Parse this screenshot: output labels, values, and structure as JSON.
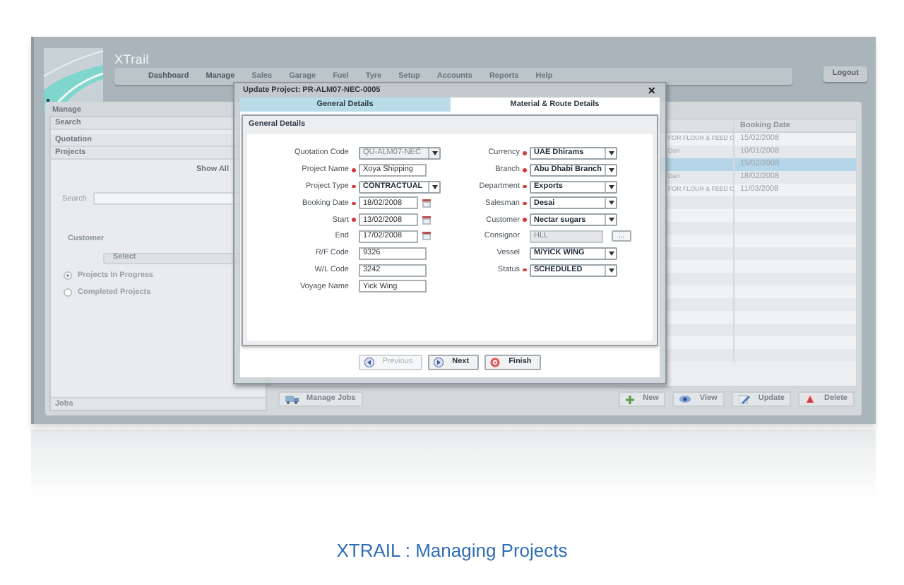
{
  "app": {
    "brand": "XTrail",
    "nav": [
      "Dashboard",
      "Manage",
      "Sales",
      "Garage",
      "Fuel",
      "Tyre",
      "Setup",
      "Accounts",
      "Reports",
      "Help"
    ],
    "logout": "Logout"
  },
  "manage_panel": {
    "title": "Manage",
    "sections": [
      "Search",
      "Quotation",
      "Projects"
    ],
    "show_all": "Show All",
    "search_label": "Search",
    "customer_label": "Customer",
    "customer_select": "Select",
    "radios": [
      {
        "label": "Projects In Progress",
        "selected": true
      },
      {
        "label": "Completed Projects",
        "selected": false
      }
    ],
    "footer": "Jobs"
  },
  "table": {
    "booking_date_header": "Booking Date",
    "rows": [
      {
        "column_1": "FOR FLOUR & FEED C",
        "booking_date": "15/02/2008",
        "selected": false
      },
      {
        "column_1": "Dan",
        "booking_date": "10/01/2008",
        "selected": false
      },
      {
        "booking_date": "15/02/2008",
        "selected": true
      },
      {
        "column_1": "Dan",
        "booking_date": "18/02/2008",
        "selected": false
      },
      {
        "column_1": "FOR FLOUR & FEED C",
        "booking_date": "11/03/2008",
        "selected": false
      }
    ]
  },
  "bottom_bar": {
    "manage_jobs": "Manage Jobs",
    "actions": [
      {
        "label": "New",
        "kind": "new"
      },
      {
        "label": "View",
        "kind": "view"
      },
      {
        "label": "Update",
        "kind": "update"
      },
      {
        "label": "Delete",
        "kind": "delete"
      }
    ]
  },
  "dialog": {
    "title": "Update Project: PR-ALM07-NEC-0005",
    "close": "×",
    "tabs": [
      {
        "label": "General Details",
        "selected": true
      },
      {
        "label": "Material & Route Details",
        "selected": false
      }
    ],
    "section_title": "General Details",
    "left_fields": [
      {
        "label": "Quotation Code",
        "required": false,
        "kind": "select",
        "value": "QU-ALM07-NEC",
        "disabled": true
      },
      {
        "label": "Project Name",
        "required": true,
        "kind": "text",
        "value": "Xoya Shipping",
        "disabled": false
      },
      {
        "label": "Project Type",
        "required": true,
        "kind": "select",
        "value": "CONTRACTUAL",
        "disabled": false
      },
      {
        "label": "Booking Date",
        "required": true,
        "kind": "date",
        "value": "18/02/2008",
        "disabled": false
      },
      {
        "label": "Start",
        "required": true,
        "kind": "date",
        "value": "13/02/2008",
        "disabled": false
      },
      {
        "label": "End",
        "required": false,
        "kind": "date",
        "value": "17/02/2008",
        "disabled": false
      },
      {
        "label": "R/F Code",
        "required": false,
        "kind": "text",
        "value": "9326",
        "disabled": false
      },
      {
        "label": "W/L Code",
        "required": false,
        "kind": "text",
        "value": "3242",
        "disabled": false
      },
      {
        "label": "Voyage Name",
        "required": false,
        "kind": "text",
        "value": "Yick Wing",
        "disabled": false
      }
    ],
    "right_fields": [
      {
        "label": "Currency",
        "required": true,
        "kind": "select",
        "value": "UAE Dhirams",
        "disabled": false
      },
      {
        "label": "Branch",
        "required": true,
        "kind": "select",
        "value": "Abu Dhabi Branch",
        "disabled": false
      },
      {
        "label": "Department",
        "required": true,
        "kind": "select",
        "value": "Exports",
        "disabled": false
      },
      {
        "label": "Salesman",
        "required": true,
        "kind": "select",
        "value": "Desai",
        "disabled": false
      },
      {
        "label": "Customer",
        "required": true,
        "kind": "select",
        "value": "Nectar sugars",
        "disabled": false
      },
      {
        "label": "Consignor",
        "required": false,
        "kind": "lookup",
        "value": "HLL",
        "disabled": true,
        "button": "..."
      },
      {
        "label": "Vessel",
        "required": false,
        "kind": "select",
        "value": "M/YICK WING",
        "disabled": false
      },
      {
        "label": "Status",
        "required": true,
        "kind": "select",
        "value": "SCHEDULED",
        "disabled": false
      }
    ],
    "buttons": [
      {
        "label": "Previous",
        "kind": "previous",
        "disabled": true
      },
      {
        "label": "Next",
        "kind": "next",
        "disabled": false
      },
      {
        "label": "Finish",
        "kind": "finish",
        "disabled": false
      }
    ]
  },
  "caption": "XTRAIL : Managing Projects"
}
